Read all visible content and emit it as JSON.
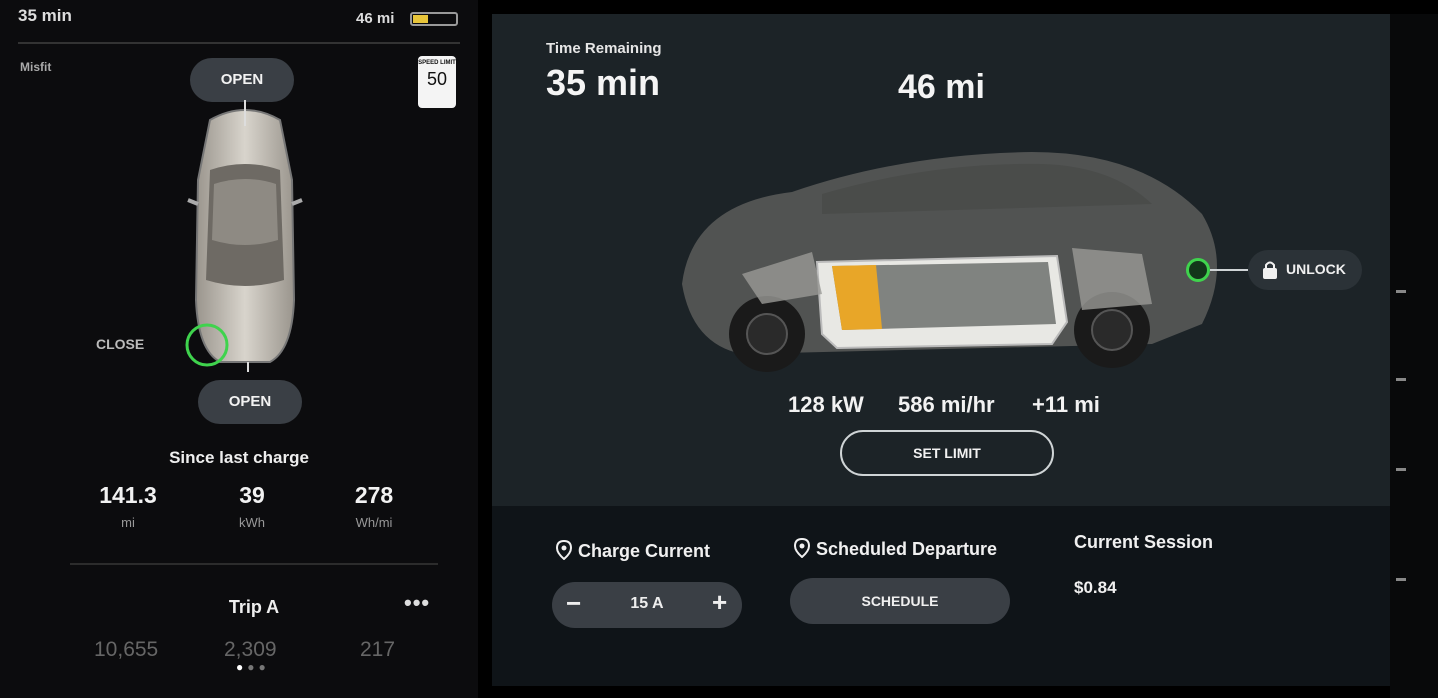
{
  "status": {
    "time_remaining": "35 min",
    "range": "46 mi",
    "battery_level": 0.35,
    "battery_color": "#e8c53a"
  },
  "left": {
    "driver_profile": "Misfit",
    "speed_limit": {
      "caption": "SPEED LIMIT",
      "value": "50"
    },
    "trunk_label": "OPEN",
    "frunk_label": "OPEN",
    "charge_port_label": "CLOSE",
    "since_last_charge": {
      "title": "Since last charge",
      "stats": [
        {
          "value": "141.3",
          "unit": "mi"
        },
        {
          "value": "39",
          "unit": "kWh"
        },
        {
          "value": "278",
          "unit": "Wh/mi"
        }
      ]
    },
    "trip": {
      "title": "Trip A",
      "more_label": "•••",
      "values": [
        "10,655",
        "2,309",
        "217"
      ]
    },
    "pager": {
      "total": 3,
      "active": 1
    }
  },
  "charging": {
    "time_remaining_label": "Time Remaining",
    "time_remaining_value": "35 min",
    "range_value": "46 mi",
    "battery_fill": 0.2,
    "unlock_label": "UNLOCK",
    "metrics": {
      "power": "128 kW",
      "rate": "586 mi/hr",
      "added": "+11 mi"
    },
    "set_limit_label": "SET LIMIT"
  },
  "controls": {
    "charge_current": {
      "title": "Charge Current",
      "value": "15 A",
      "minus": "−",
      "plus": "+"
    },
    "scheduled_departure": {
      "title": "Scheduled Departure",
      "button": "SCHEDULE"
    },
    "current_session": {
      "title": "Current Session",
      "value": "$0.84"
    }
  },
  "colors": {
    "accent_green": "#3fd34d",
    "charge_fill": "#e8a628",
    "panel_bg": "#1c2327",
    "button_bg": "#3a3f45"
  }
}
